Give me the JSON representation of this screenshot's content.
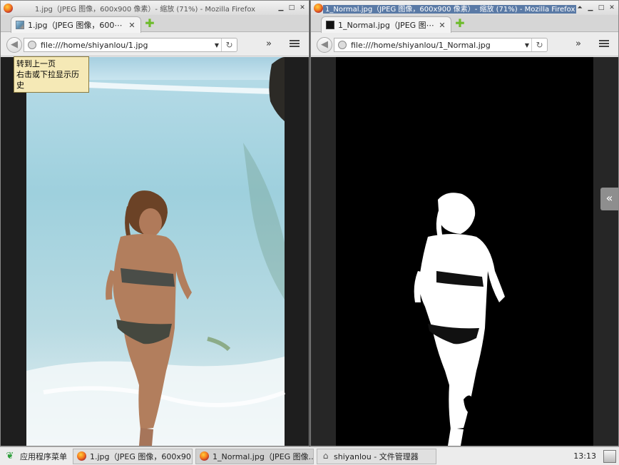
{
  "left_window": {
    "title": "1.jpg（JPEG 图像，600x900 像素）- 缩放 (71%) - Mozilla Firefox",
    "tab_label": "1.jpg（JPEG 图像，600⋯",
    "url": "file:///home/shiyanlou/1.jpg",
    "tooltip_line1": "转到上一页",
    "tooltip_line2": "右击或下拉显示历史"
  },
  "right_window": {
    "title": "1_Normal.jpg（JPEG 图像，600x900 像素）- 缩放 (71%) - Mozilla Firefox",
    "tab_label": "1_Normal.jpg（JPEG 图⋯",
    "url": "file:///home/shiyanlou/1_Normal.jpg"
  },
  "window_buttons": {
    "shade": "⏶",
    "minimize": "▁",
    "maximize": "□",
    "close": "✕"
  },
  "toolbar": {
    "new_tab": "✚",
    "back": "◀",
    "dropdown": "▼",
    "reload": "↻",
    "overflow": "»"
  },
  "side_handle": "«",
  "taskbar": {
    "menu_label": "应用程序菜单",
    "tasks": [
      {
        "label": "1.jpg（JPEG 图像，600x90⋯"
      },
      {
        "label": "1_Normal.jpg（JPEG 图像..."
      },
      {
        "label": "shiyanlou - 文件管理器"
      }
    ],
    "clock": "13:13"
  }
}
